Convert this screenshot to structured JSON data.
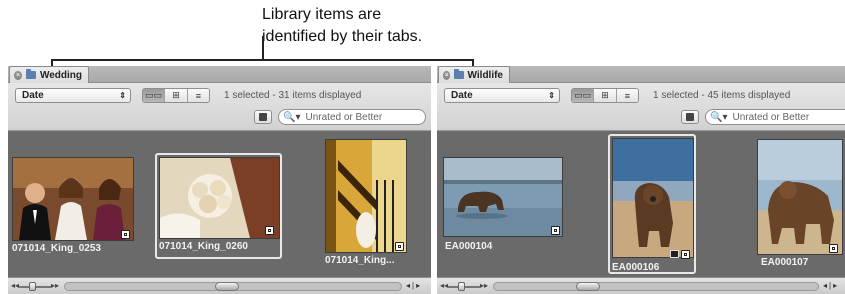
{
  "callout": {
    "line1": "Library items are",
    "line2": "identified by their tabs."
  },
  "panels": [
    {
      "tab": "Wedding",
      "sort": "Date",
      "status": "1 selected - 31 items displayed",
      "search_placeholder": "Unrated or Better",
      "items": [
        {
          "caption": "071014_King_0253",
          "selected": false
        },
        {
          "caption": "071014_King_0260",
          "selected": true
        },
        {
          "caption": "071014_King...",
          "selected": false
        }
      ]
    },
    {
      "tab": "Wildlife",
      "sort": "Date",
      "status": "1 selected - 45 items displayed",
      "search_placeholder": "Unrated or Better",
      "items": [
        {
          "caption": "EA000104",
          "selected": false
        },
        {
          "caption": "EA000106",
          "selected": true
        },
        {
          "caption": "EA000107",
          "selected": false
        }
      ]
    }
  ],
  "icons": {
    "close": "close-icon",
    "folder": "folder-icon",
    "filmstrip_view": "filmstrip-view-icon",
    "grid_view": "grid-view-icon",
    "list_view": "list-view-icon",
    "search": "search-icon",
    "filter": "filter-icon",
    "badge": "master-badge-icon"
  }
}
